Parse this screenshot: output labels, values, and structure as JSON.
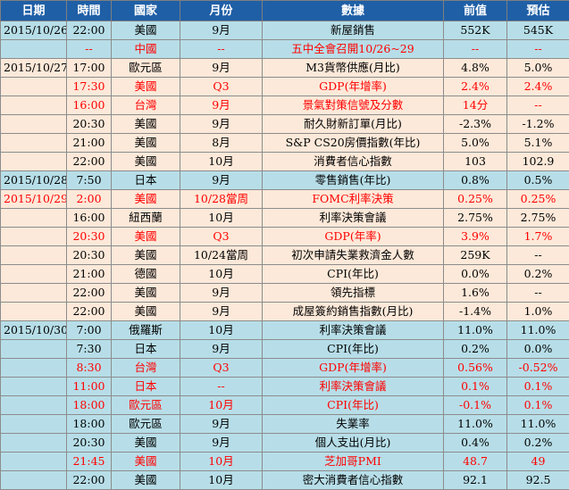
{
  "headers": [
    "日期",
    "時間",
    "國家",
    "月份",
    "數據",
    "前值",
    "預估"
  ],
  "rows": [
    {
      "g": "blue",
      "red": false,
      "date": "2015/10/26",
      "time": "22:00",
      "country": "美國",
      "period": "9月",
      "event": "新屋銷售",
      "prev": "552K",
      "forecast": "545K"
    },
    {
      "g": "blue",
      "red": true,
      "date": "",
      "time": "--",
      "country": "中國",
      "period": "--",
      "event": "五中全會召開10/26~29",
      "prev": "--",
      "forecast": "--"
    },
    {
      "g": "peach",
      "red": false,
      "date": "2015/10/27",
      "time": "17:00",
      "country": "歐元區",
      "period": "9月",
      "event": "M3貨幣供應(月比)",
      "prev": "4.8%",
      "forecast": "5.0%"
    },
    {
      "g": "peach",
      "red": true,
      "date": "",
      "time": "17:30",
      "country": "美國",
      "period": "Q3",
      "event": "GDP(年增率)",
      "prev": "2.4%",
      "forecast": "2.4%"
    },
    {
      "g": "peach",
      "red": true,
      "date": "",
      "time": "16:00",
      "country": "台灣",
      "period": "9月",
      "event": "景氣對策信號及分數",
      "prev": "14分",
      "forecast": "--"
    },
    {
      "g": "peach",
      "red": false,
      "date": "",
      "time": "20:30",
      "country": "美國",
      "period": "9月",
      "event": "耐久財新訂單(月比)",
      "prev": "-2.3%",
      "forecast": "-1.2%"
    },
    {
      "g": "peach",
      "red": false,
      "date": "",
      "time": "21:00",
      "country": "美國",
      "period": "8月",
      "event": "S&P CS20房價指數(年比)",
      "prev": "5.0%",
      "forecast": "5.1%"
    },
    {
      "g": "peach",
      "red": false,
      "date": "",
      "time": "22:00",
      "country": "美國",
      "period": "10月",
      "event": "消費者信心指數",
      "prev": "103",
      "forecast": "102.9"
    },
    {
      "g": "blue",
      "red": false,
      "date": "2015/10/28",
      "time": "7:50",
      "country": "日本",
      "period": "9月",
      "event": "零售銷售(年比)",
      "prev": "0.8%",
      "forecast": "0.5%"
    },
    {
      "g": "peach",
      "red": true,
      "date": "2015/10/29",
      "time": "2:00",
      "country": "美國",
      "period": "10/28當周",
      "event": "FOMC利率決策",
      "prev": "0.25%",
      "forecast": "0.25%"
    },
    {
      "g": "peach",
      "red": false,
      "date": "",
      "time": "16:00",
      "country": "紐西蘭",
      "period": "10月",
      "event": "利率決策會議",
      "prev": "2.75%",
      "forecast": "2.75%"
    },
    {
      "g": "peach",
      "red": true,
      "date": "",
      "time": "20:30",
      "country": "美國",
      "period": "Q3",
      "event": "GDP(年率)",
      "prev": "3.9%",
      "forecast": "1.7%"
    },
    {
      "g": "peach",
      "red": false,
      "date": "",
      "time": "20:30",
      "country": "美國",
      "period": "10/24當周",
      "event": "初次申請失業救濟金人數",
      "prev": "259K",
      "forecast": "--"
    },
    {
      "g": "peach",
      "red": false,
      "date": "",
      "time": "21:00",
      "country": "德國",
      "period": "10月",
      "event": "CPI(年比)",
      "prev": "0.0%",
      "forecast": "0.2%"
    },
    {
      "g": "peach",
      "red": false,
      "date": "",
      "time": "22:00",
      "country": "美國",
      "period": "9月",
      "event": "領先指標",
      "prev": "1.6%",
      "forecast": "--"
    },
    {
      "g": "peach",
      "red": false,
      "date": "",
      "time": "22:00",
      "country": "美國",
      "period": "9月",
      "event": "成屋簽約銷售指數(月比)",
      "prev": "-1.4%",
      "forecast": "1.0%"
    },
    {
      "g": "blue",
      "red": false,
      "date": "2015/10/30",
      "time": "7:00",
      "country": "俄羅斯",
      "period": "10月",
      "event": "利率決策會議",
      "prev": "11.0%",
      "forecast": "11.0%"
    },
    {
      "g": "blue",
      "red": false,
      "date": "",
      "time": "7:30",
      "country": "日本",
      "period": "9月",
      "event": "CPI(年比)",
      "prev": "0.2%",
      "forecast": "0.0%"
    },
    {
      "g": "blue",
      "red": true,
      "date": "",
      "time": "8:30",
      "country": "台灣",
      "period": "Q3",
      "event": "GDP(年增率)",
      "prev": "0.56%",
      "forecast": "-0.52%"
    },
    {
      "g": "blue",
      "red": true,
      "date": "",
      "time": "11:00",
      "country": "日本",
      "period": "--",
      "event": "利率決策會議",
      "prev": "0.1%",
      "forecast": "0.1%"
    },
    {
      "g": "blue",
      "red": true,
      "date": "",
      "time": "18:00",
      "country": "歐元區",
      "period": "10月",
      "event": "CPI(年比)",
      "prev": "-0.1%",
      "forecast": "0.1%"
    },
    {
      "g": "blue",
      "red": false,
      "date": "",
      "time": "18:00",
      "country": "歐元區",
      "period": "9月",
      "event": "失業率",
      "prev": "11.0%",
      "forecast": "11.0%"
    },
    {
      "g": "blue",
      "red": false,
      "date": "",
      "time": "20:30",
      "country": "美國",
      "period": "9月",
      "event": "個人支出(月比)",
      "prev": "0.4%",
      "forecast": "0.2%"
    },
    {
      "g": "blue",
      "red": true,
      "date": "",
      "time": "21:45",
      "country": "美國",
      "period": "10月",
      "event": "芝加哥PMI",
      "prev": "48.7",
      "forecast": "49"
    },
    {
      "g": "blue",
      "red": false,
      "date": "",
      "time": "22:00",
      "country": "美國",
      "period": "10月",
      "event": "密大消費者信心指數",
      "prev": "92.1",
      "forecast": "92.5"
    }
  ],
  "colors": {
    "header_bg": "#1f5fa6",
    "blue_row": "#b7dee8",
    "peach_row": "#fde9d9",
    "highlight_text": "#ff0000"
  }
}
